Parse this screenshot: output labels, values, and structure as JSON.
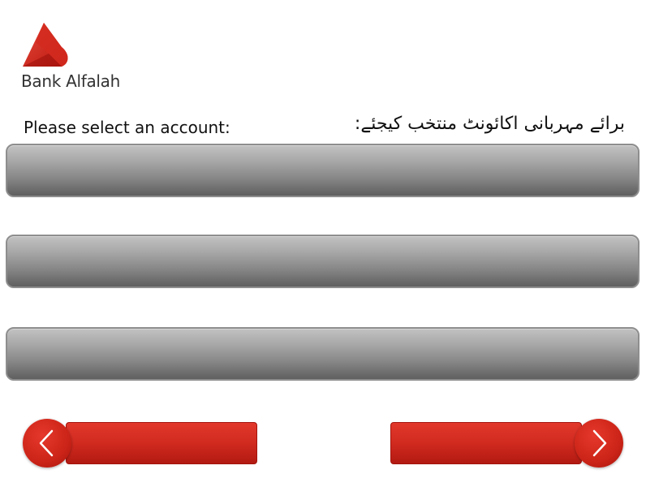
{
  "brand": {
    "name": "Bank Alfalah",
    "color": "#d42a1e"
  },
  "prompt": {
    "english": "Please select an account:",
    "urdu": "برائے مہربانی اکائونٹ منتخب کیجئے:"
  },
  "accounts": [
    {
      "label": ""
    },
    {
      "label": ""
    },
    {
      "label": ""
    }
  ],
  "navigation": {
    "back_icon": "chevron-left-icon",
    "next_icon": "chevron-right-icon"
  }
}
